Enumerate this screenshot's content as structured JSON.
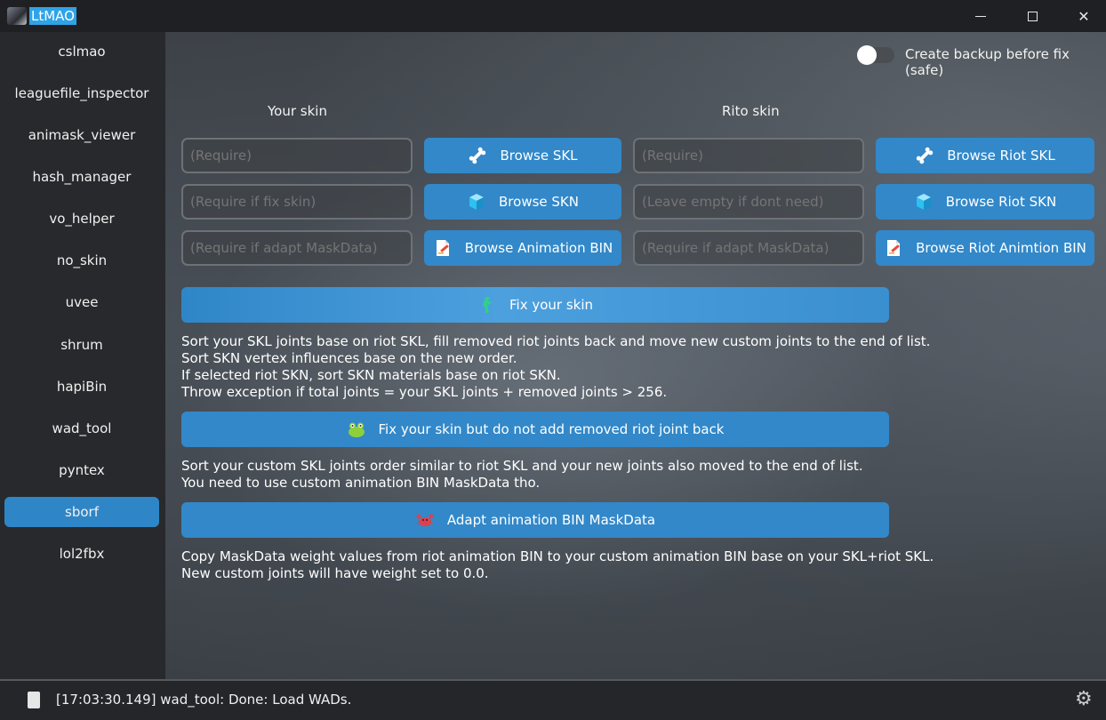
{
  "window": {
    "title": "LtMAO"
  },
  "sidebar": {
    "items": [
      {
        "label": "cslmao"
      },
      {
        "label": "leaguefile_inspector"
      },
      {
        "label": "animask_viewer"
      },
      {
        "label": "hash_manager"
      },
      {
        "label": "vo_helper"
      },
      {
        "label": "no_skin"
      },
      {
        "label": "uvee"
      },
      {
        "label": "shrum"
      },
      {
        "label": "hapiBin"
      },
      {
        "label": "wad_tool"
      },
      {
        "label": "pyntex"
      },
      {
        "label": "sborf"
      },
      {
        "label": "lol2fbx"
      }
    ],
    "active": "sborf"
  },
  "backup": {
    "label": "Create backup before fix (safe)",
    "enabled": false
  },
  "your_skin": {
    "header": "Your skin",
    "skl_placeholder": "(Require)",
    "skn_placeholder": "(Require if fix skin)",
    "bin_placeholder": "(Require if adapt MaskData)",
    "browse_skl": "Browse SKL",
    "browse_skn": "Browse SKN",
    "browse_bin": "Browse Animation BIN"
  },
  "rito_skin": {
    "header": "Rito skin",
    "skl_placeholder": "(Require)",
    "skn_placeholder": "(Leave empty if dont need)",
    "bin_placeholder": "(Require if adapt MaskData)",
    "browse_skl": "Browse Riot SKL",
    "browse_skn": "Browse Riot SKN",
    "browse_bin": "Browse Riot Animtion BIN"
  },
  "actions": {
    "fix": {
      "label": "Fix your skin",
      "desc": [
        "Sort your SKL joints base on riot SKL, fill removed riot joints back and move new custom joints to the end of list.",
        "Sort SKN vertex influences base on the new order.",
        "If selected riot SKN, sort SKN materials base on riot SKN.",
        "Throw exception if total joints = your SKL joints + removed joints > 256."
      ]
    },
    "fix_no_add": {
      "label": "Fix your skin but do not add removed riot joint back",
      "desc": [
        "Sort your custom SKL joints order similar to riot SKL and your new joints also moved to the end of list.",
        "You need to use custom animation BIN MaskData tho."
      ]
    },
    "adapt": {
      "label": "Adapt animation BIN MaskData",
      "desc": [
        "Copy MaskData weight values from riot animation BIN to your custom animation BIN base on your SKL+riot SKL.",
        "New custom joints will have weight set to 0.0."
      ]
    }
  },
  "status": {
    "text": "[17:03:30.149] wad_tool: Done: Load WADs."
  },
  "icons": {
    "bone": "bone-icon",
    "cube": "cube-icon",
    "document": "document-icon",
    "fix": "green-figure-icon",
    "frog": "frog-icon",
    "crab": "crab-icon",
    "gear": "gear-icon"
  }
}
